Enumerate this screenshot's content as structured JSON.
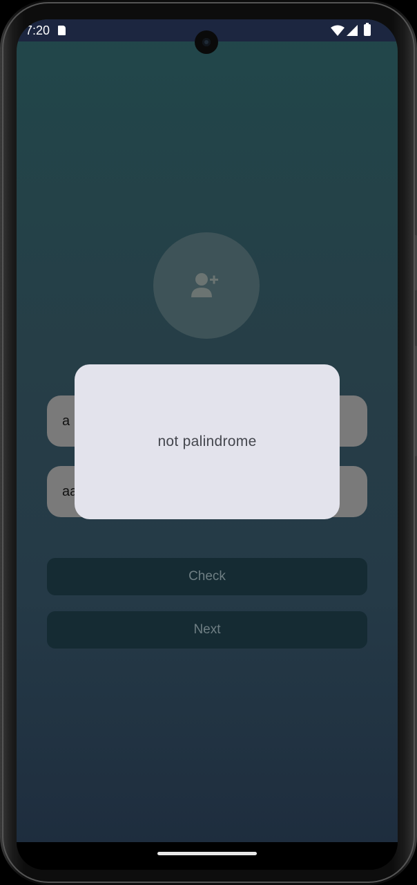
{
  "status_bar": {
    "time": "7:20",
    "icons": [
      "sd-card-icon",
      "wifi-icon",
      "signal-icon",
      "battery-icon"
    ]
  },
  "app": {
    "avatar_icon": "add-user-icon",
    "field_1_value": "a",
    "field_2_value": "aa",
    "check_label": "Check",
    "next_label": "Next"
  },
  "dialog": {
    "message": "not palindrome"
  },
  "colors": {
    "background_top": "#21474a",
    "background_bottom": "#1e2d3e",
    "button_bg": "#152b33",
    "dialog_bg": "#e3e3ec"
  }
}
